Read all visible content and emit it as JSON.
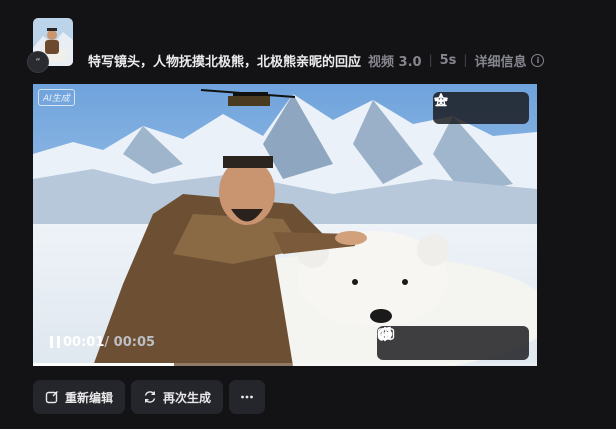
{
  "history": {
    "prompt": "特写镜头，人物抚摸北极熊，北极熊亲昵的回应",
    "model": "视频 3.0",
    "duration": "5s",
    "details_label": "详细信息",
    "thumb_badge_icon": "quote-icon"
  },
  "player": {
    "ai_tag": "AI生成",
    "current_time": "00:01",
    "total_time": "/ 00:05",
    "progress": 0.28,
    "top_tools": [
      "download-icon",
      "more-icon",
      "star-icon"
    ],
    "bottom_tools": [
      "lip-sync-icon",
      "audio-wave-icon",
      "frame-interp-icon",
      "hd-icon",
      "music-icon"
    ]
  },
  "actions": {
    "reedit_label": "重新编辑",
    "regenerate_label": "再次生成"
  },
  "colors": {
    "background": "#131316",
    "button": "#25262b",
    "muted_text": "#85868d"
  }
}
